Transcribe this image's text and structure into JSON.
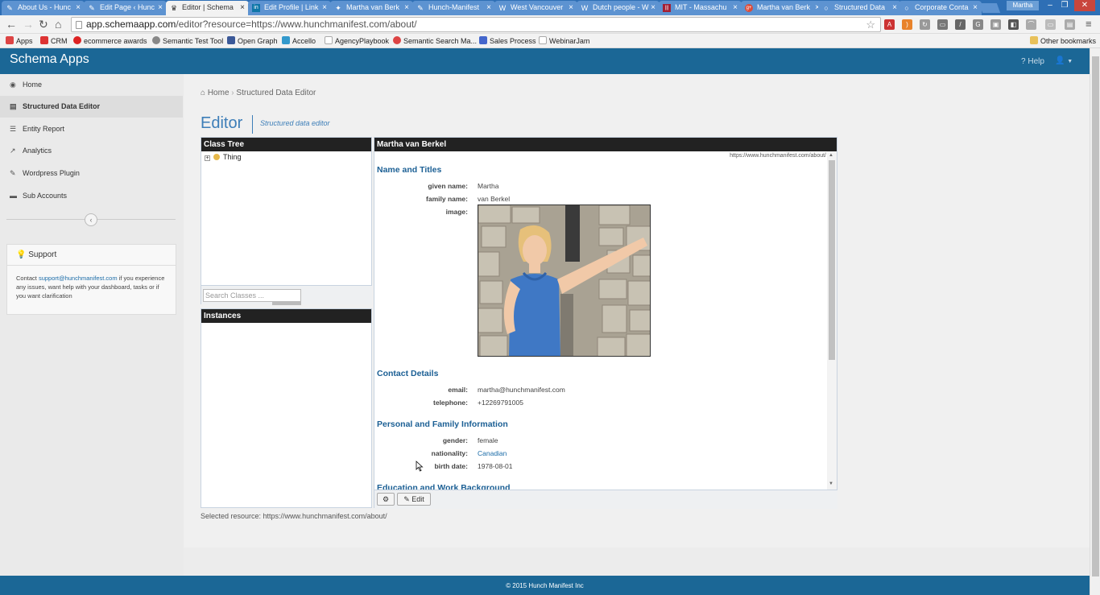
{
  "browser": {
    "tabs": [
      {
        "title": "About Us - Hunc",
        "icon": "feather-icon"
      },
      {
        "title": "Edit Page ‹ Hunc",
        "icon": "feather-icon"
      },
      {
        "title": "Editor | Schema",
        "icon": "crown-icon"
      },
      {
        "title": "Edit Profile | Link",
        "icon": "linkedin-icon"
      },
      {
        "title": "Martha van Berk",
        "icon": "twitter-icon"
      },
      {
        "title": "Hunch-Manifest",
        "icon": "feather-icon"
      },
      {
        "title": "West Vancouver",
        "icon": "wikipedia-icon"
      },
      {
        "title": "Dutch people - W",
        "icon": "wikipedia-icon"
      },
      {
        "title": "MIT - Massachu",
        "icon": "mit-icon"
      },
      {
        "title": "Martha van Berk",
        "icon": "google-plus-icon"
      },
      {
        "title": "Structured Data",
        "icon": "circle-icon"
      },
      {
        "title": "Corporate Conta",
        "icon": "circle-icon"
      }
    ],
    "profile_name": "Martha",
    "url": {
      "host": "app.schemaapp.com",
      "path": "/editor?resource=https://www.hunchmanifest.com/about/"
    },
    "bookmarks": [
      {
        "label": "Apps",
        "color": "#d44"
      },
      {
        "label": "CRM",
        "color": "#d33"
      },
      {
        "label": "ecommerce awards",
        "color": "#d22"
      },
      {
        "label": "Semantic Test Tool",
        "color": "#888"
      },
      {
        "label": "Open Graph",
        "color": "#3b5998"
      },
      {
        "label": "Accello",
        "color": "#39c"
      },
      {
        "label": "AgencyPlaybook",
        "color": "#aaa"
      },
      {
        "label": "Semantic Search Ma...",
        "color": "#d44"
      },
      {
        "label": "Sales Process",
        "color": "#46c"
      },
      {
        "label": "WebinarJam",
        "color": "#aaa"
      }
    ],
    "other_bookmarks": "Other bookmarks"
  },
  "app": {
    "brand": "Schema Apps",
    "help": "Help",
    "accent": "#1b6796"
  },
  "sidebar": {
    "items": [
      {
        "label": "Home",
        "icon": "dashboard-icon"
      },
      {
        "label": "Structured Data Editor",
        "icon": "document-icon"
      },
      {
        "label": "Entity Report",
        "icon": "list-icon"
      },
      {
        "label": "Analytics",
        "icon": "chart-icon"
      },
      {
        "label": "Wordpress Plugin",
        "icon": "plug-icon"
      },
      {
        "label": "Sub Accounts",
        "icon": "folder-icon"
      }
    ],
    "support_title": "Support",
    "support_pre": "Contact ",
    "support_email": "support@hunchmanifest.com",
    "support_post": " if you experience any issues, want help with your dashboard, tasks or if you want clarification"
  },
  "main": {
    "breadcrumb_home": "Home",
    "breadcrumb_current": "Structured Data Editor",
    "title": "Editor",
    "subtitle": "Structured data editor",
    "class_tree_title": "Class Tree",
    "tree_root": "Thing",
    "search_placeholder": "Search Classes ...",
    "instances_title": "Instances",
    "entity_title": "Martha van Berkel",
    "resource_url": "https://www.hunchmanifest.com/about/",
    "sections": {
      "names": "Name and Titles",
      "contact": "Contact Details",
      "personal": "Personal and Family Information",
      "education": "Education and Work Background"
    },
    "props": {
      "given_name_label": "given name:",
      "given_name": "Martha",
      "family_name_label": "family name:",
      "family_name": "van Berkel",
      "image_label": "image:",
      "email_label": "email:",
      "email": "martha@hunchmanifest.com",
      "telephone_label": "telephone:",
      "telephone": "+12269791005",
      "gender_label": "gender:",
      "gender": "female",
      "nationality_label": "nationality:",
      "nationality": "Canadian",
      "birth_date_label": "birth date:",
      "birth_date": "1978-08-01"
    },
    "edit_label": "Edit",
    "selected_label": "Selected resource: ",
    "selected_value": "https://www.hunchmanifest.com/about/"
  },
  "footer": "© 2015 Hunch Manifest Inc"
}
